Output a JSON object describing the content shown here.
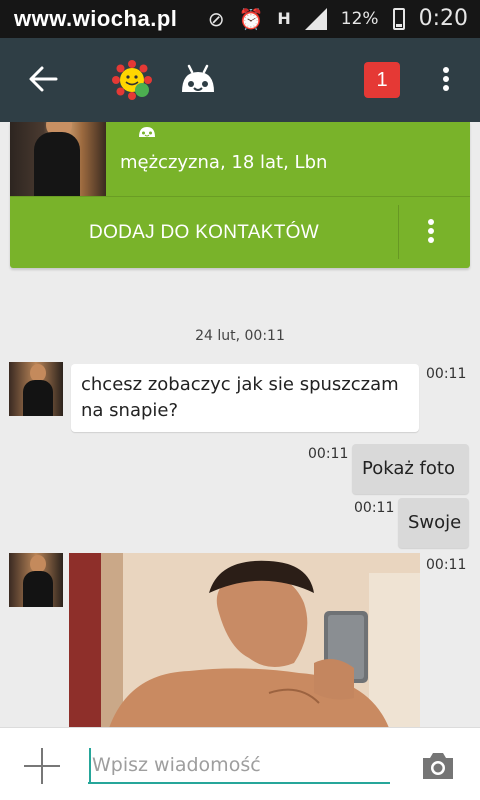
{
  "status_bar": {
    "watermark": "www.wiocha.pl",
    "battery_percent": "12%",
    "time": "0:20",
    "network": "H"
  },
  "app_bar": {
    "notification_count": "1",
    "icons": [
      "back-arrow-icon",
      "sun-logo-icon",
      "android-robot-icon",
      "overflow-menu-icon"
    ]
  },
  "profile": {
    "info": "mężczyzna, 18 lat, Lbn",
    "add_contact_label": "DODAJ DO KONTAKTÓW",
    "accent_color": "#79b32a"
  },
  "chat": {
    "date_separator": "24 lut, 00:11",
    "messages": [
      {
        "direction": "incoming",
        "text": "chcesz zobaczyc jak sie spuszczam na snapie?",
        "time": "00:11"
      },
      {
        "direction": "outgoing",
        "text": "Pokaż foto",
        "time": "00:11"
      },
      {
        "direction": "outgoing",
        "text": "Swoje",
        "time": "00:11"
      },
      {
        "direction": "incoming",
        "type": "photo",
        "time": "00:11"
      }
    ]
  },
  "composer": {
    "placeholder": "Wpisz wiadomość",
    "value": ""
  }
}
